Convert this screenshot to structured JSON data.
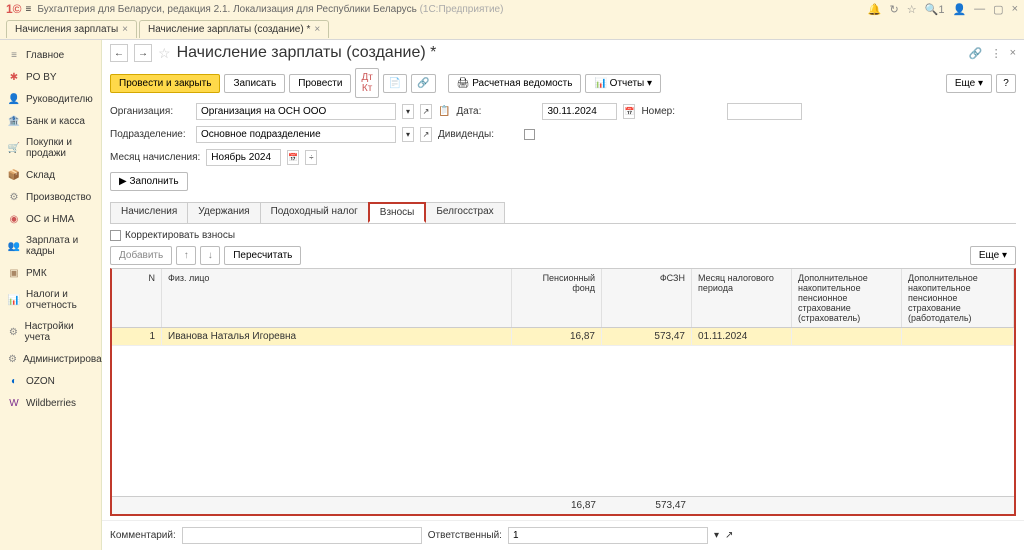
{
  "titlebar": {
    "app_title": "Бухгалтерия для Беларуси, редакция 2.1. Локализация для Республики Беларусь",
    "app_suffix": "(1С:Предприятие)",
    "search_count": "1"
  },
  "tabs": [
    {
      "label": "Начисления зарплаты"
    },
    {
      "label": "Начисление зарплаты (создание) *"
    }
  ],
  "sidebar": {
    "items": [
      {
        "label": "Главное",
        "icon": "≡",
        "color": "#888"
      },
      {
        "label": "PO BY",
        "icon": "✱",
        "color": "#d9534f"
      },
      {
        "label": "Руководителю",
        "icon": "👤",
        "color": "#6a8"
      },
      {
        "label": "Банк и касса",
        "icon": "🏦",
        "color": "#c99"
      },
      {
        "label": "Покупки и продажи",
        "icon": "🛒",
        "color": "#8a6"
      },
      {
        "label": "Склад",
        "icon": "📦",
        "color": "#a86"
      },
      {
        "label": "Производство",
        "icon": "⚙",
        "color": "#888"
      },
      {
        "label": "ОС и НМА",
        "icon": "◉",
        "color": "#c55"
      },
      {
        "label": "Зарплата и кадры",
        "icon": "👥",
        "color": "#6a8"
      },
      {
        "label": "РМК",
        "icon": "▣",
        "color": "#a86"
      },
      {
        "label": "Налоги и отчетность",
        "icon": "📊",
        "color": "#888"
      },
      {
        "label": "Настройки учета",
        "icon": "⚙",
        "color": "#888"
      },
      {
        "label": "Администрирование",
        "icon": "⚙",
        "color": "#888"
      },
      {
        "label": "OZON",
        "icon": "◐",
        "color": "#0066cc"
      },
      {
        "label": "Wildberries",
        "icon": "W",
        "color": "#7b2d8e"
      }
    ]
  },
  "page": {
    "title": "Начисление зарплаты (создание) *"
  },
  "toolbar": {
    "provesti_zakryt": "Провести и закрыть",
    "zapisat": "Записать",
    "provesti": "Провести",
    "raschet_ved": "Расчетная ведомость",
    "otchety": "Отчеты",
    "eshe": "Еще",
    "help": "?"
  },
  "form": {
    "org_label": "Организация:",
    "org_value": "Организация на ОСН ООО",
    "data_label": "Дата:",
    "data_value": "30.11.2024",
    "nomer_label": "Номер:",
    "podr_label": "Подразделение:",
    "podr_value": "Основное подразделение",
    "dividend_label": "Дивиденды:",
    "mes_label": "Месяц начисления:",
    "mes_value": "Ноябрь 2024",
    "zapolnit": "Заполнить"
  },
  "inner_tabs": {
    "nachisleniya": "Начисления",
    "uderzhaniya": "Удержания",
    "podohod": "Подоходный налог",
    "vznosy": "Взносы",
    "belgosstrah": "Белгосстрах"
  },
  "tab_content": {
    "korr_label": "Корректировать взносы",
    "dobavit": "Добавить",
    "pereschitat": "Пересчитать",
    "eshe": "Еще"
  },
  "grid": {
    "headers": {
      "n": "N",
      "fiz": "Физ. лицо",
      "pens": "Пенсионный фонд",
      "fszn": "ФСЗН",
      "mes": "Месяц налогового периода",
      "dop1": "Дополнительное накопительное пенсионное страхование (страхователь)",
      "dop2": "Дополнительное накопительное пенсионное страхование (работодатель)"
    },
    "rows": [
      {
        "n": "1",
        "fiz": "Иванова Наталья Игоревна",
        "pens": "16,87",
        "fszn": "573,47",
        "mes": "01.11.2024",
        "dop1": "",
        "dop2": ""
      }
    ],
    "footer": {
      "pens": "16,87",
      "fszn": "573,47"
    }
  },
  "bottom": {
    "komm_label": "Комментарий:",
    "otv_label": "Ответственный:",
    "otv_value": "1"
  }
}
